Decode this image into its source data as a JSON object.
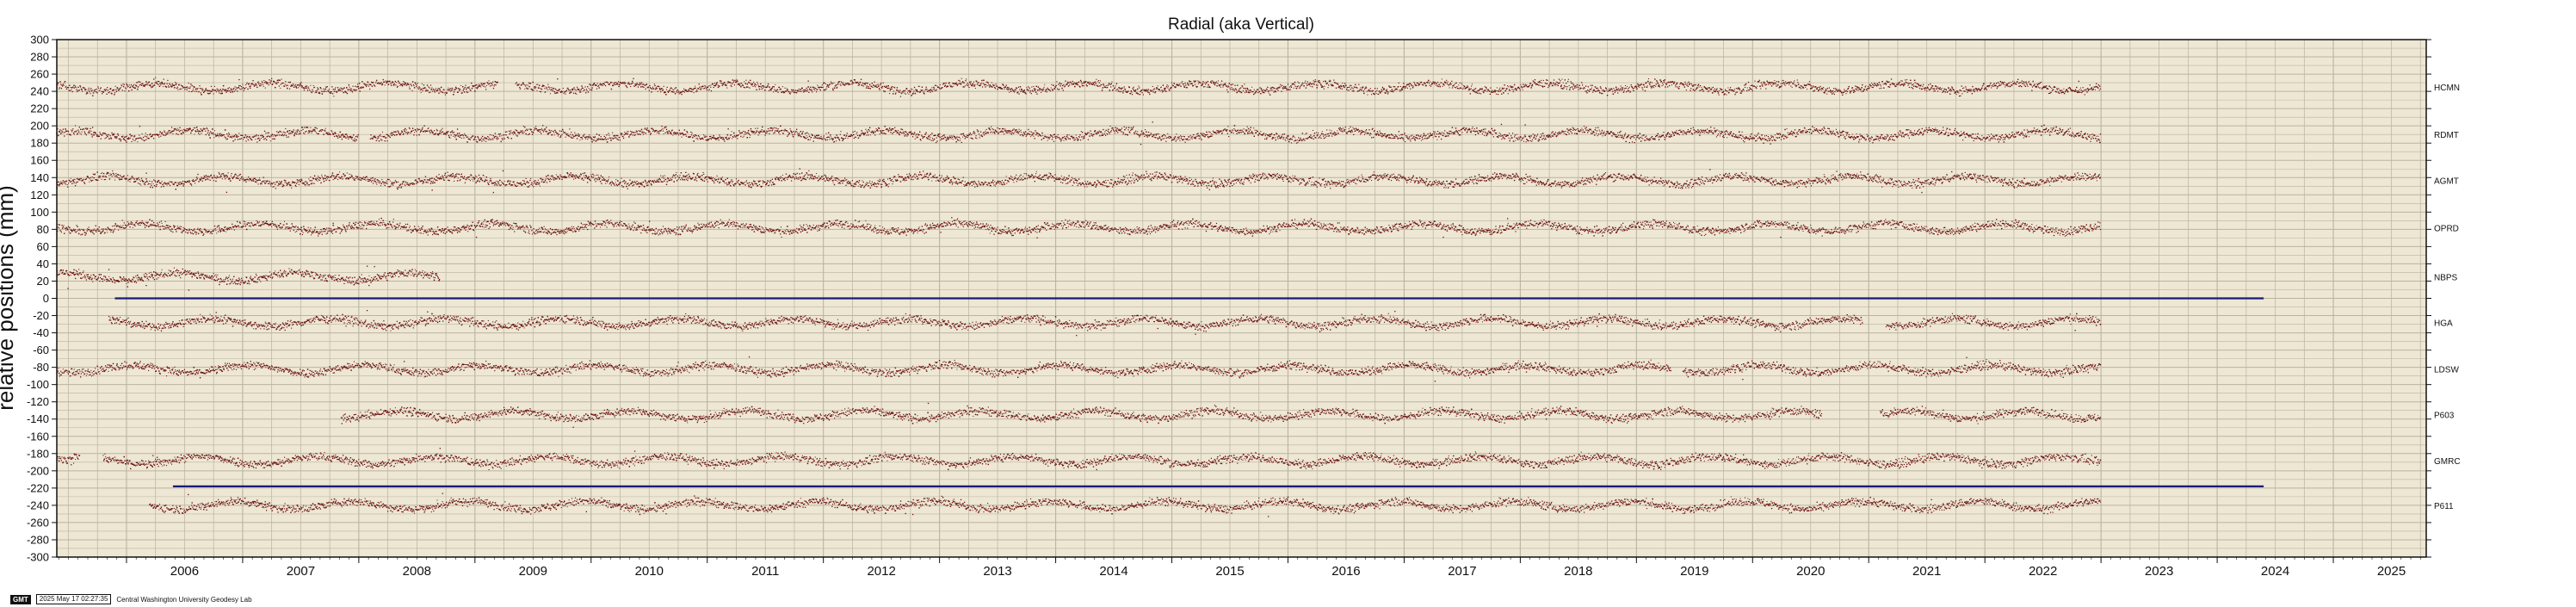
{
  "chart_data": {
    "type": "scatter",
    "title": "Radial (aka Vertical)",
    "ylabel": "relative positions (mm)",
    "xlabel": "",
    "xlim": [
      2005.4,
      2025.8
    ],
    "ylim": [
      -300,
      300
    ],
    "x_ticks": [
      "2006",
      "2007",
      "2008",
      "2009",
      "2010",
      "2011",
      "2012",
      "2013",
      "2014",
      "2015",
      "2016",
      "2017",
      "2018",
      "2019",
      "2020",
      "2021",
      "2022",
      "2023",
      "2024",
      "2025"
    ],
    "y_ticks": [
      300,
      280,
      260,
      240,
      220,
      200,
      180,
      160,
      140,
      120,
      100,
      80,
      60,
      40,
      20,
      0,
      -20,
      -40,
      -60,
      -80,
      -100,
      -120,
      -140,
      -160,
      -180,
      -200,
      -220,
      -240,
      -260,
      -280,
      -300
    ],
    "grid": true,
    "reference_lines": [
      {
        "y": 0,
        "x_start": 2005.9,
        "x_end": 2024.4,
        "color": "#1a1a7a"
      },
      {
        "y": -218,
        "x_start": 2006.4,
        "x_end": 2024.4,
        "color": "#1a1a7a"
      }
    ],
    "series": [
      {
        "name": "HCMN",
        "offset": 245,
        "x_start": 2005.4,
        "x_end": 2023.0,
        "gaps": [
          [
            2009.2,
            2009.35
          ]
        ]
      },
      {
        "name": "RDMT",
        "offset": 190,
        "x_start": 2005.4,
        "x_end": 2023.0,
        "gaps": [
          [
            2008.0,
            2008.1
          ]
        ]
      },
      {
        "name": "AGMT",
        "offset": 137,
        "x_start": 2005.4,
        "x_end": 2023.0,
        "gaps": []
      },
      {
        "name": "OPRD",
        "offset": 82,
        "x_start": 2005.4,
        "x_end": 2023.0,
        "gaps": []
      },
      {
        "name": "NBPS",
        "offset": 25,
        "x_start": 2005.4,
        "x_end": 2008.7,
        "gaps": []
      },
      {
        "name": "HGA",
        "offset": -28,
        "x_start": 2005.85,
        "x_end": 2023.0,
        "gaps": [
          [
            2020.95,
            2021.15
          ]
        ]
      },
      {
        "name": "LDSW",
        "offset": -82,
        "x_start": 2005.4,
        "x_end": 2023.0,
        "gaps": [
          [
            2019.3,
            2019.4
          ]
        ]
      },
      {
        "name": "P603",
        "offset": -135,
        "x_start": 2007.85,
        "x_end": 2023.0,
        "gaps": [
          [
            2020.6,
            2021.1
          ]
        ]
      },
      {
        "name": "GMRC",
        "offset": -188,
        "x_start": 2005.4,
        "x_end": 2023.0,
        "gaps": [
          [
            2005.6,
            2005.8
          ]
        ]
      },
      {
        "name": "P611",
        "offset": -240,
        "x_start": 2006.2,
        "x_end": 2023.0,
        "gaps": []
      }
    ],
    "marker_color": "#6b0f0f",
    "background_color": "#ede7d3",
    "grid_color": "#b9b39f"
  },
  "footer": {
    "logo": "GMT",
    "timestamp": "2025 May 17 02:27:35",
    "credit": "Central Washington University Geodesy Lab"
  }
}
